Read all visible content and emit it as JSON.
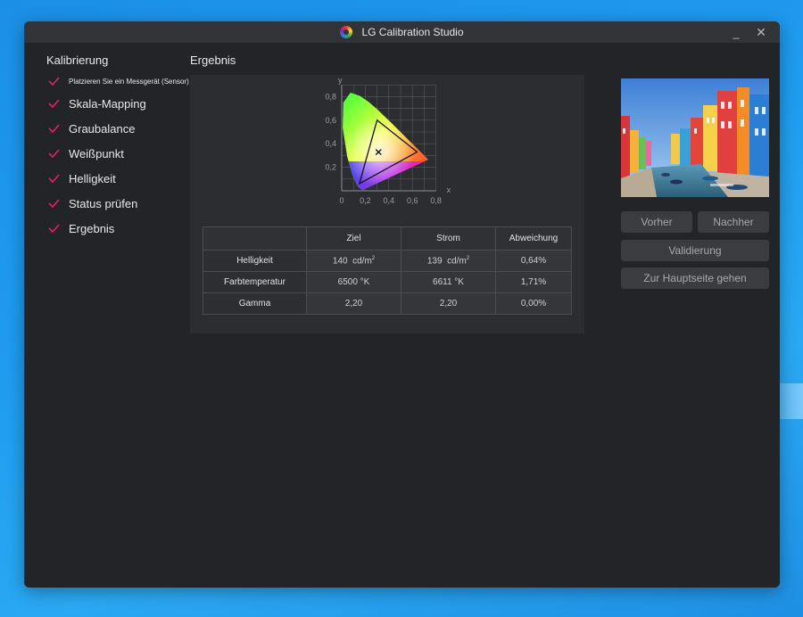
{
  "window": {
    "title": "LG Calibration Studio",
    "minimize_glyph": "_",
    "close_glyph": "✕"
  },
  "sidebar": {
    "heading": "Kalibrierung",
    "steps": [
      {
        "label": "Platzieren Sie ein Messgerät (Sensor)",
        "done": true
      },
      {
        "label": "Skala-Mapping",
        "done": true
      },
      {
        "label": "Graubalance",
        "done": true
      },
      {
        "label": "Weißpunkt",
        "done": true
      },
      {
        "label": "Helligkeit",
        "done": true
      },
      {
        "label": "Status prüfen",
        "done": true
      },
      {
        "label": "Ergebnis",
        "done": true
      }
    ]
  },
  "result": {
    "heading": "Ergebnis",
    "chart_data": {
      "type": "scatter",
      "title": "",
      "xlabel": "x",
      "ylabel": "y",
      "xlim": [
        0,
        0.8
      ],
      "ylim": [
        0,
        0.9
      ],
      "x_ticks": [
        "0",
        "0,2",
        "0,4",
        "0,6",
        "0,8"
      ],
      "y_ticks": [
        "0,2",
        "0,4",
        "0,6",
        "0,8"
      ],
      "grid": true,
      "gamut_triangle": [
        [
          0.64,
          0.33
        ],
        [
          0.3,
          0.6
        ],
        [
          0.15,
          0.06
        ]
      ],
      "white_point": [
        0.3127,
        0.329
      ]
    },
    "table": {
      "headers": [
        "",
        "Ziel",
        "Strom",
        "Abweichung"
      ],
      "rows": [
        {
          "label": "Helligkeit",
          "target": "140",
          "target_unit": "cd/m",
          "current": "139",
          "current_unit": "cd/m",
          "sup": "2",
          "deviation": "0,64%"
        },
        {
          "label": "Farbtemperatur",
          "target": "6500 °K",
          "current": "6611 °K",
          "deviation": "1,71%"
        },
        {
          "label": "Gamma",
          "target": "2,20",
          "current": "2,20",
          "deviation": "0,00%"
        }
      ]
    }
  },
  "actions": {
    "before": "Vorher",
    "after": "Nachher",
    "validate": "Validierung",
    "home": "Zur Hauptseite gehen"
  },
  "colors": {
    "check": "#e0245e",
    "panel": "#2b2d31",
    "window": "#222427"
  }
}
